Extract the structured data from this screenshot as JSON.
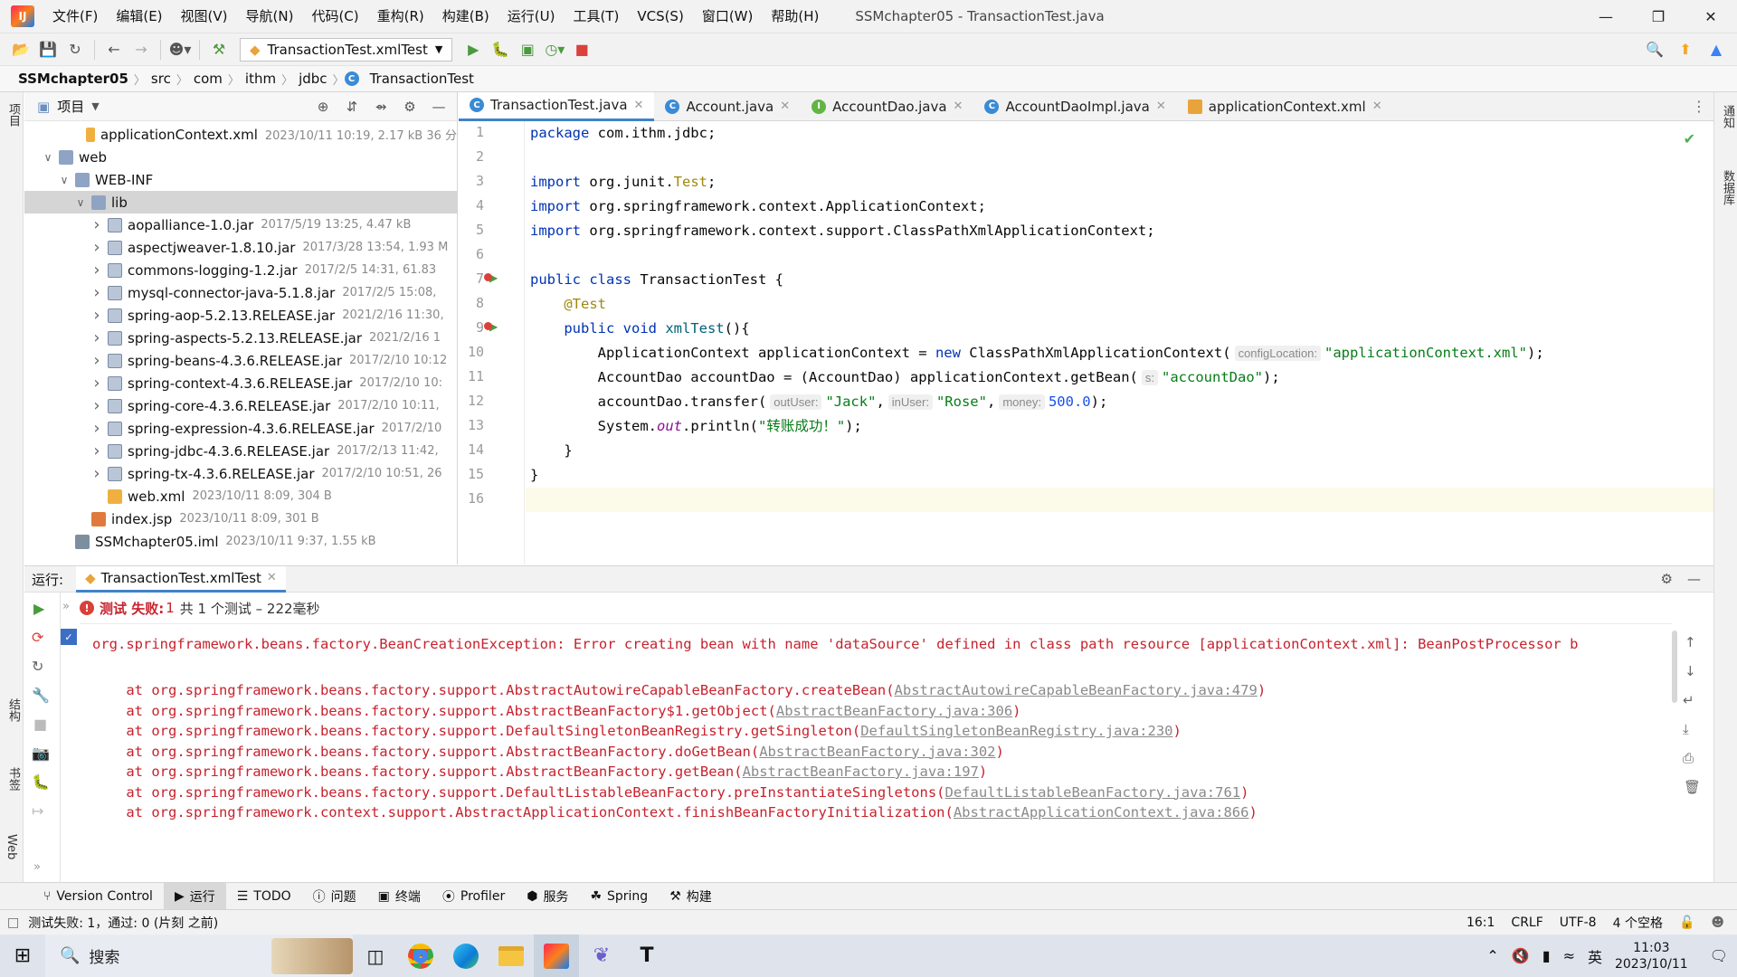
{
  "menubar": {
    "items": [
      "文件(F)",
      "编辑(E)",
      "视图(V)",
      "导航(N)",
      "代码(C)",
      "重构(R)",
      "构建(B)",
      "运行(U)",
      "工具(T)",
      "VCS(S)",
      "窗口(W)",
      "帮助(H)"
    ],
    "title": "SSMchapter05 - TransactionTest.java"
  },
  "toolbar": {
    "run_config": "TransactionTest.xmlTest"
  },
  "breadcrumb": [
    "SSMchapter05",
    "src",
    "com",
    "ithm",
    "jdbc",
    "TransactionTest"
  ],
  "side_labels": {
    "left_top": "项目",
    "left_mid": "结构",
    "left_book": "书签",
    "left_web": "Web",
    "right_top": "通知",
    "right_mid": "数据库"
  },
  "project": {
    "header": "项目",
    "tree": [
      {
        "name": "applicationContext.xml",
        "meta": "2023/10/11 10:19, 2.17 kB 36 分",
        "icon": "xml",
        "indent": 3,
        "arrow": ""
      },
      {
        "name": "web",
        "meta": "",
        "icon": "fold",
        "indent": 1,
        "arrow": "v"
      },
      {
        "name": "WEB-INF",
        "meta": "",
        "icon": "fold",
        "indent": 2,
        "arrow": "v"
      },
      {
        "name": "lib",
        "meta": "",
        "icon": "fold",
        "indent": 3,
        "arrow": "v",
        "selected": true
      },
      {
        "name": "aopalliance-1.0.jar",
        "meta": "2017/5/19 13:25, 4.47 kB",
        "icon": "jar",
        "indent": 4,
        "arrow": ">"
      },
      {
        "name": "aspectjweaver-1.8.10.jar",
        "meta": "2017/3/28 13:54, 1.93 M",
        "icon": "jar",
        "indent": 4,
        "arrow": ">"
      },
      {
        "name": "commons-logging-1.2.jar",
        "meta": "2017/2/5 14:31, 61.83",
        "icon": "jar",
        "indent": 4,
        "arrow": ">"
      },
      {
        "name": "mysql-connector-java-5.1.8.jar",
        "meta": "2017/2/5 15:08,",
        "icon": "jar",
        "indent": 4,
        "arrow": ">"
      },
      {
        "name": "spring-aop-5.2.13.RELEASE.jar",
        "meta": "2021/2/16 11:30,",
        "icon": "jar",
        "indent": 4,
        "arrow": ">"
      },
      {
        "name": "spring-aspects-5.2.13.RELEASE.jar",
        "meta": "2021/2/16 1",
        "icon": "jar",
        "indent": 4,
        "arrow": ">"
      },
      {
        "name": "spring-beans-4.3.6.RELEASE.jar",
        "meta": "2017/2/10 10:12",
        "icon": "jar",
        "indent": 4,
        "arrow": ">"
      },
      {
        "name": "spring-context-4.3.6.RELEASE.jar",
        "meta": "2017/2/10 10:",
        "icon": "jar",
        "indent": 4,
        "arrow": ">"
      },
      {
        "name": "spring-core-4.3.6.RELEASE.jar",
        "meta": "2017/2/10 10:11,",
        "icon": "jar",
        "indent": 4,
        "arrow": ">"
      },
      {
        "name": "spring-expression-4.3.6.RELEASE.jar",
        "meta": "2017/2/10",
        "icon": "jar",
        "indent": 4,
        "arrow": ">"
      },
      {
        "name": "spring-jdbc-4.3.6.RELEASE.jar",
        "meta": "2017/2/13 11:42,",
        "icon": "jar",
        "indent": 4,
        "arrow": ">"
      },
      {
        "name": "spring-tx-4.3.6.RELEASE.jar",
        "meta": "2017/2/10 10:51, 26",
        "icon": "jar",
        "indent": 4,
        "arrow": ">"
      },
      {
        "name": "web.xml",
        "meta": "2023/10/11 8:09, 304 B",
        "icon": "xml",
        "indent": 4,
        "arrow": ""
      },
      {
        "name": "index.jsp",
        "meta": "2023/10/11 8:09, 301 B",
        "icon": "jsp",
        "indent": 3,
        "arrow": ""
      },
      {
        "name": "SSMchapter05.iml",
        "meta": "2023/10/11 9:37, 1.55 kB",
        "icon": "iml",
        "indent": 2,
        "arrow": ""
      }
    ]
  },
  "editor_tabs": [
    {
      "label": "TransactionTest.java",
      "icon": "c-class",
      "glyph": "C",
      "active": true
    },
    {
      "label": "Account.java",
      "icon": "c-class",
      "glyph": "C",
      "active": false
    },
    {
      "label": "AccountDao.java",
      "icon": "c-int",
      "glyph": "I",
      "active": false
    },
    {
      "label": "AccountDaoImpl.java",
      "icon": "c-class",
      "glyph": "C",
      "active": false
    },
    {
      "label": "applicationContext.xml",
      "icon": "c-xml",
      "glyph": "",
      "active": false
    }
  ],
  "code": {
    "line_numbers": [
      "1",
      "2",
      "3",
      "4",
      "5",
      "6",
      "7",
      "8",
      "9",
      "10",
      "11",
      "12",
      "13",
      "14",
      "15",
      "16"
    ],
    "l1_kw": "package",
    "l1_rest": " com.ithm.jdbc;",
    "l3_kw": "import",
    "l3_a": " org.junit.",
    "l3_b": "Test",
    "l3_c": ";",
    "l4_kw": "import",
    "l4_rest": " org.springframework.context.ApplicationContext;",
    "l5_kw": "import",
    "l5_rest": " org.springframework.context.support.ClassPathXmlApplicationContext;",
    "l7_kw": "public class",
    "l7_rest": " TransactionTest {",
    "l8": "@Test",
    "l9_kw": "public void",
    "l9_name": " xmlTest",
    "l9_rest": "(){",
    "l10_a": "ApplicationContext applicationContext = ",
    "l10_kw": "new",
    "l10_b": " ClassPathXmlApplicationContext(",
    "l10_hint": "configLocation:",
    "l10_str": "\"applicationContext.xml\"",
    "l10_c": ");",
    "l11_a": "AccountDao accountDao = (AccountDao) applicationContext.getBean(",
    "l11_hint": "s:",
    "l11_str": "\"accountDao\"",
    "l11_c": ");",
    "l12_a": "accountDao.transfer(",
    "l12_h1": "outUser:",
    "l12_s1": "\"Jack\"",
    "l12_sep1": ",",
    "l12_h2": "inUser:",
    "l12_s2": "\"Rose\"",
    "l12_sep2": ",",
    "l12_h3": "money:",
    "l12_n": "500.0",
    "l12_c": ");",
    "l13_a": "System.",
    "l13_out": "out",
    "l13_b": ".println(",
    "l13_str": "\"转账成功！\"",
    "l13_c": ");",
    "l14": "}",
    "l15": "}"
  },
  "run": {
    "label": "运行:",
    "tab": "TransactionTest.xmlTest",
    "status_bold": "测试 失败:",
    "status_count": "1",
    "status_detail": "共 1 个测试 – 222毫秒",
    "console": [
      {
        "text": "org.springframework.beans.factory.BeanCreationException: Error creating bean with name 'dataSource' defined in class path resource [applicationContext.xml]: BeanPostProcessor b",
        "link": ""
      },
      {
        "text": "",
        "link": ""
      },
      {
        "text": "    at org.springframework.beans.factory.support.AbstractAutowireCapableBeanFactory.createBean(",
        "link": "AbstractAutowireCapableBeanFactory.java:479",
        "end": ")"
      },
      {
        "text": "    at org.springframework.beans.factory.support.AbstractBeanFactory$1.getObject(",
        "link": "AbstractBeanFactory.java:306",
        "end": ")"
      },
      {
        "text": "    at org.springframework.beans.factory.support.DefaultSingletonBeanRegistry.getSingleton(",
        "link": "DefaultSingletonBeanRegistry.java:230",
        "end": ")"
      },
      {
        "text": "    at org.springframework.beans.factory.support.AbstractBeanFactory.doGetBean(",
        "link": "AbstractBeanFactory.java:302",
        "end": ")"
      },
      {
        "text": "    at org.springframework.beans.factory.support.AbstractBeanFactory.getBean(",
        "link": "AbstractBeanFactory.java:197",
        "end": ")"
      },
      {
        "text": "    at org.springframework.beans.factory.support.DefaultListableBeanFactory.preInstantiateSingletons(",
        "link": "DefaultListableBeanFactory.java:761",
        "end": ")"
      },
      {
        "text": "    at org.springframework.context.support.AbstractApplicationContext.finishBeanFactoryInitialization(",
        "link": "AbstractApplicationContext.java:866",
        "end": ")"
      }
    ]
  },
  "bottom_tabs": [
    "Version Control",
    "运行",
    "TODO",
    "问题",
    "终端",
    "Profiler",
    "服务",
    "Spring",
    "构建"
  ],
  "status": {
    "message": "测试失败: 1，通过: 0 (片刻 之前)",
    "position": "16:1",
    "line_sep": "CRLF",
    "encoding": "UTF-8",
    "indent": "4 个空格"
  },
  "taskbar": {
    "search": "搜索",
    "ime": "英",
    "time": "11:03",
    "date": "2023/10/11"
  }
}
